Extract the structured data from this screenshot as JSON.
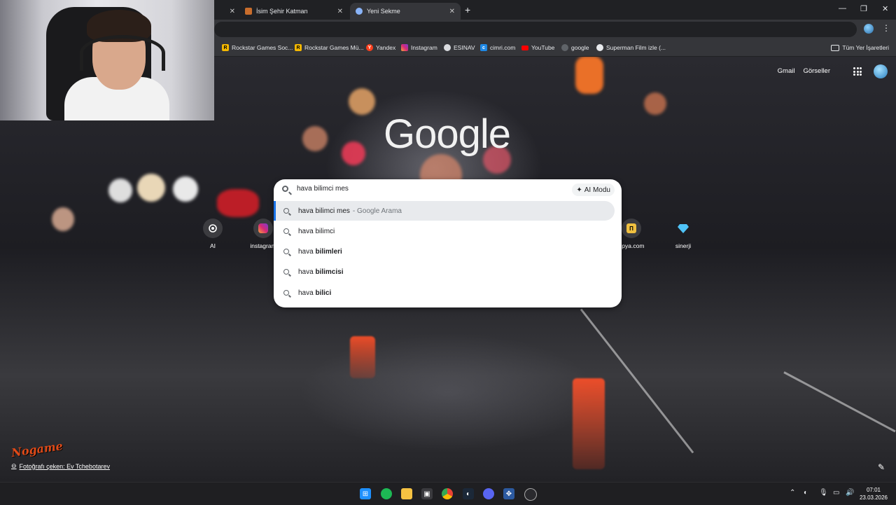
{
  "tabs": [
    {
      "label": "",
      "active": false
    },
    {
      "label": "İsim Şehir Katman",
      "active": false
    },
    {
      "label": "Yeni Sekme",
      "active": true
    }
  ],
  "bookmarks": [
    {
      "label": "Rockstar Games Soc...",
      "icon": "rockstar-icon"
    },
    {
      "label": "Rockstar Games Mü...",
      "icon": "rockstar-icon"
    },
    {
      "label": "Yandex",
      "icon": "yandex-icon"
    },
    {
      "label": "Instagram",
      "icon": "instagram-icon"
    },
    {
      "label": "ESINAV",
      "icon": "globe-icon"
    },
    {
      "label": "cimri.com",
      "icon": "cimri-icon"
    },
    {
      "label": "YouTube",
      "icon": "youtube-icon"
    },
    {
      "label": "google",
      "icon": "globe-icon"
    },
    {
      "label": "Superman Film izle (...",
      "icon": "superman-icon"
    }
  ],
  "bookmarks_all": "Tüm Yer İşaretleri",
  "google_header": {
    "gmail": "Gmail",
    "images": "Görseller"
  },
  "logo": "Google",
  "search": {
    "query": "hava bilimci mes",
    "ai_mode": "AI Modu",
    "suggestions": [
      {
        "prefix": "hava bilimci mes",
        "bold": "",
        "sub": "- Google Arama"
      },
      {
        "prefix": "hava bilimci",
        "bold": "",
        "sub": ""
      },
      {
        "prefix": "hava ",
        "bold": "bilimleri",
        "sub": ""
      },
      {
        "prefix": "hava ",
        "bold": "bilimcisi",
        "sub": ""
      },
      {
        "prefix": "hava ",
        "bold": "bilici",
        "sub": ""
      }
    ]
  },
  "shortcuts": [
    {
      "label": "AI"
    },
    {
      "label": "instagram"
    },
    {
      "label": "epya.com"
    },
    {
      "label": "sinerji"
    }
  ],
  "credit": "Fotoğrafı çeken: Ev Tchebotarev",
  "watermark": "Nogame",
  "clock": {
    "time": "07:01",
    "date": "23.03.2026"
  },
  "colors": {
    "tabbar": "#202124",
    "toolbar": "#35363a",
    "accent": "#1a73e8"
  }
}
